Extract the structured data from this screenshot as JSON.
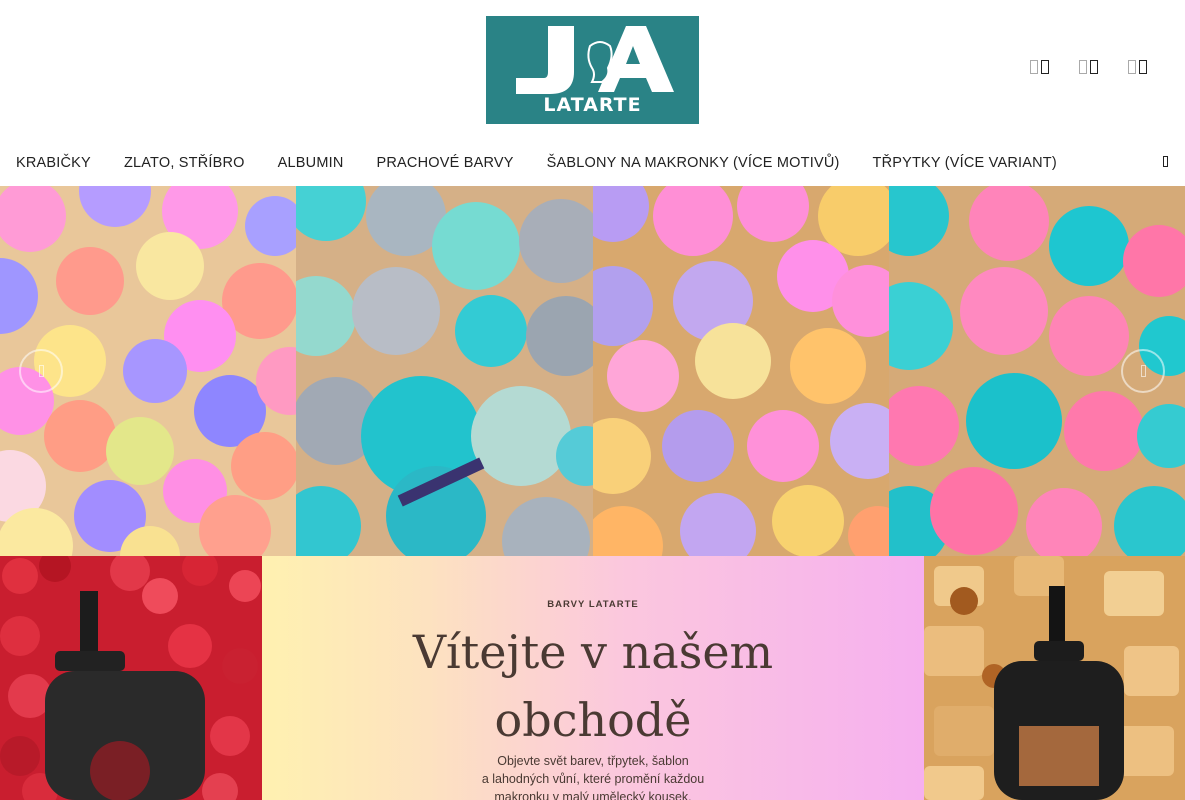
{
  "header": {
    "logo": {
      "letters": "JA",
      "name": "LATARTE",
      "bg_color": "#2a8386"
    },
    "icons": [
      {
        "name": "search-icon"
      },
      {
        "name": "account-icon"
      },
      {
        "name": "cart-icon"
      }
    ]
  },
  "nav": {
    "items": [
      {
        "label": "KRABIČKY"
      },
      {
        "label": "ZLATO, STŘÍBRO"
      },
      {
        "label": "ALBUMIN"
      },
      {
        "label": "PRACHOVÉ BARVY"
      },
      {
        "label": "ŠABLONY NA MAKRONKY (VÍCE MOTIVŮ)"
      },
      {
        "label": "TŘPYTKY (VÍCE VARIANT)"
      }
    ],
    "more_icon": "chevron-down-icon"
  },
  "hero": {
    "panels": [
      "macarons-pastel",
      "macarons-turquoise",
      "macarons-purple-yellow",
      "macarons-pink-turquoise"
    ],
    "prev_icon": "chevron-left-icon",
    "next_icon": "chevron-right-icon"
  },
  "banner": {
    "brand": "BARVY LATARTE",
    "title_line1": "Vítejte v našem",
    "title_line2": "obchodě",
    "description": "Objevte svět barev, třpytek, šablon\na lahodných vůní, které promění každou\nmakronku v malý umělecký kousek.",
    "left_image": "raspberries-bottle",
    "right_image": "caramel-bottle"
  },
  "colors": {
    "accent": "#2a8386",
    "scrollbar": "#fbd3ee",
    "text": "#222222"
  }
}
